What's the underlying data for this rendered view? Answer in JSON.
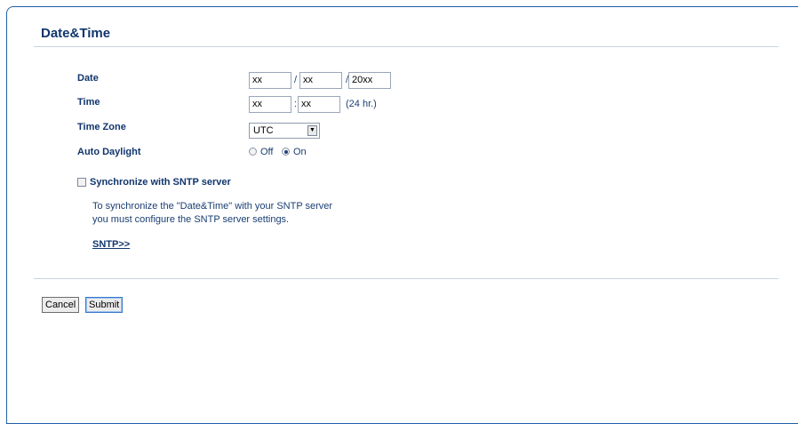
{
  "page": {
    "title": "Date&Time"
  },
  "date": {
    "label": "Date",
    "field1": "xx",
    "sep1": "/",
    "field2": "xx",
    "sep2": "/",
    "field3": "20xx"
  },
  "time": {
    "label": "Time",
    "hour": "xx",
    "sep": ":",
    "minute": "xx",
    "suffix": "(24 hr.)"
  },
  "timezone": {
    "label": "Time Zone",
    "selected": "UTC"
  },
  "daylight": {
    "label": "Auto Daylight",
    "off_label": "Off",
    "on_label": "On",
    "selected": "On"
  },
  "sync": {
    "label": "Synchronize with SNTP server",
    "checked": false,
    "desc_line1": "To synchronize the \"Date&Time\" with your SNTP server",
    "desc_line2": "you must configure the SNTP server settings.",
    "link": "SNTP>>"
  },
  "buttons": {
    "cancel": "Cancel",
    "submit": "Submit"
  },
  "colors": {
    "heading": "#10356d",
    "text": "#1a3e72",
    "border": "#1f5fa8"
  }
}
